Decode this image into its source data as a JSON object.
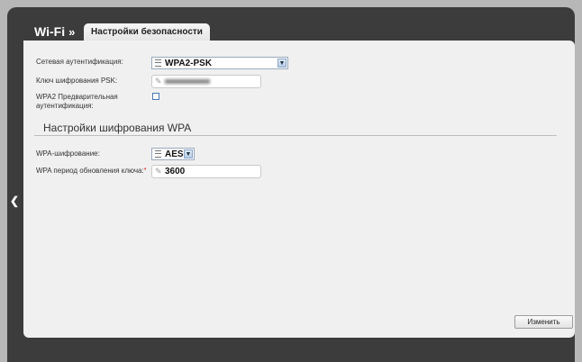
{
  "header": {
    "brand": "Wi-Fi",
    "brand_arrow": "»",
    "tab_label": "Настройки безопасности"
  },
  "form": {
    "auth_label": "Сетевая аутентификация:",
    "auth_value": "WPA2-PSK",
    "psk_label": "Ключ шифрования PSK:",
    "preauth_label_line1": "WPA2 Предварительная",
    "preauth_label_line2": "аутентификация:",
    "preauth_checked": false,
    "section_title": "Настройки шифрования WPA",
    "encryption_label": "WPA-шифрование:",
    "encryption_value": "AES",
    "rekey_label": "WPA период обновления ключа:",
    "rekey_required_mark": "*",
    "rekey_value": "3600"
  },
  "actions": {
    "submit_label": "Изменить"
  },
  "icons": {
    "collapse": "chevron-left-icon",
    "list": "list-icon",
    "dropdown": "chevron-down-icon",
    "edit": "pencil-icon"
  }
}
